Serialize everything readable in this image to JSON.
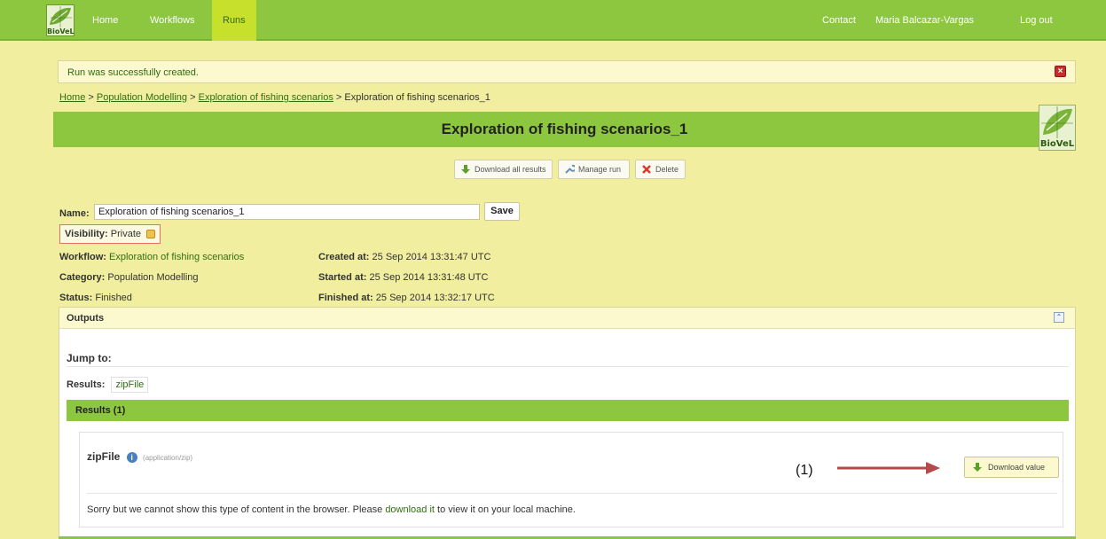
{
  "nav": {
    "logo_text": "BioVeL",
    "items": [
      {
        "label": "Home",
        "active": false
      },
      {
        "label": "Workflows",
        "active": false
      },
      {
        "label": "Runs",
        "active": true
      }
    ],
    "right": {
      "contact": "Contact",
      "user": "Maria Balcazar-Vargas",
      "logout": "Log out"
    }
  },
  "flash": {
    "message": "Run was successfully created.",
    "close_icon": "close-icon"
  },
  "breadcrumb": {
    "home": "Home",
    "sep": ">",
    "category": "Population Modelling",
    "workflow": "Exploration of fishing scenarios",
    "current": "Exploration of fishing scenarios_1"
  },
  "page": {
    "title": "Exploration of fishing scenarios_1"
  },
  "actions": {
    "download_all": "Download all results",
    "manage": "Manage run",
    "delete": "Delete"
  },
  "run": {
    "name_label": "Name:",
    "name_value": "Exploration of fishing scenarios_1",
    "save_label": "Save",
    "visibility_label": "Visibility:",
    "visibility_value": "Private",
    "workflow_label": "Workflow:",
    "workflow_value": "Exploration of fishing scenarios",
    "category_label": "Category:",
    "category_value": "Population Modelling",
    "status_label": "Status:",
    "status_value": "Finished",
    "created_label": "Created at:",
    "created_value": "25 Sep 2014 13:31:47 UTC",
    "started_label": "Started at:",
    "started_value": "25 Sep 2014 13:31:48 UTC",
    "finished_label": "Finished at:",
    "finished_value": "25 Sep 2014 13:32:17 UTC"
  },
  "outputs": {
    "title": "Outputs",
    "jump_label": "Jump to:",
    "results_label": "Results:",
    "results_link": "zipFile",
    "results_header": "Results (1)",
    "item": {
      "name": "zipFile",
      "mime": "(application/zip)",
      "download_label": "Download value",
      "message_before": "Sorry but we cannot show this type of content in the browser. Please",
      "message_link": "download it",
      "message_after": "to view it on your local machine."
    }
  },
  "annotation": {
    "label": "(1)"
  },
  "colors": {
    "nav": "#8dc63f",
    "active_tab": "#c7e02c",
    "page_bg": "#f1ee9f",
    "link": "#2f6f10",
    "arrow": "#b64a4a"
  }
}
